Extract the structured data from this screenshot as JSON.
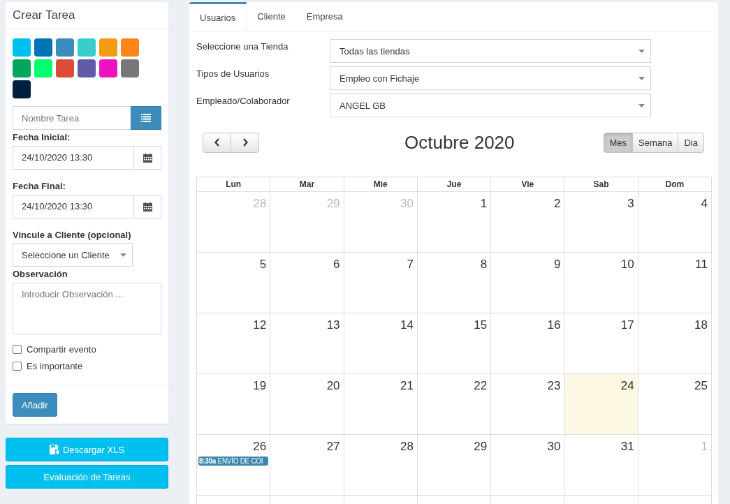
{
  "task_form": {
    "title": "Crear Tarea",
    "swatches": [
      {
        "color": "#00c0ef"
      },
      {
        "color": "#0073b7"
      },
      {
        "color": "#3c8dbc"
      },
      {
        "color": "#39cccc"
      },
      {
        "color": "#f39c12"
      },
      {
        "color": "#ff851b"
      },
      {
        "color": "#00a65a"
      },
      {
        "color": "#01ff70"
      },
      {
        "color": "#dd4b39"
      },
      {
        "color": "#605ca8"
      },
      {
        "color": "#f012be"
      },
      {
        "color": "#777777"
      },
      {
        "color": "#001f3f"
      }
    ],
    "name_field": {
      "placeholder": "Nombre Tarea"
    },
    "start_label": "Fecha Inicial:",
    "start_value": "24/10/2020 13:30",
    "end_label": "Fecha Final:",
    "end_value": "24/10/2020 13:30",
    "client_label": "Vincule a Cliente (opcional)",
    "client_select": "Seleccione un Cliente",
    "notes_label": "Observación",
    "notes": {
      "placeholder": "Introducir Observación ..."
    },
    "checkboxes": [
      {
        "label": "Compartir evento",
        "checked": false
      },
      {
        "label": "Es importante",
        "checked": false
      }
    ],
    "submit": "Añadir"
  },
  "side_buttons": [
    {
      "label": "Descargar XLS",
      "kind": "download"
    },
    {
      "label": "Evaluación de Tareas",
      "kind": "plain"
    }
  ],
  "tabs": [
    {
      "label": "Usuarios",
      "selected": true
    },
    {
      "label": "Cliente",
      "selected": false
    },
    {
      "label": "Empresa",
      "selected": false
    }
  ],
  "filters": [
    {
      "label": "Seleccione una Tienda",
      "value": "Todas las tiendas"
    },
    {
      "label": "Tipos de Usuarios",
      "value": "Empleo con Fichaje"
    },
    {
      "label": "Empleado/Colaborador",
      "value": "ANGEL GB"
    }
  ],
  "calendar": {
    "title": "Octubre 2020",
    "views": [
      {
        "label": "Mes",
        "selected": true
      },
      {
        "label": "Semana",
        "selected": false
      },
      {
        "label": "Dia",
        "selected": false
      }
    ],
    "weekdays": [
      "Lun",
      "Mar",
      "Mie",
      "Jue",
      "Vie",
      "Sab",
      "Dom"
    ],
    "weeks": [
      [
        {
          "day": "28",
          "other": true
        },
        {
          "day": "29",
          "other": true
        },
        {
          "day": "30",
          "other": true
        },
        {
          "day": "1",
          "other": false
        },
        {
          "day": "2",
          "other": false
        },
        {
          "day": "3",
          "other": false
        },
        {
          "day": "4",
          "other": false
        }
      ],
      [
        {
          "day": "5",
          "other": false
        },
        {
          "day": "6",
          "other": false
        },
        {
          "day": "7",
          "other": false
        },
        {
          "day": "8",
          "other": false
        },
        {
          "day": "9",
          "other": false
        },
        {
          "day": "10",
          "other": false
        },
        {
          "day": "11",
          "other": false
        }
      ],
      [
        {
          "day": "12",
          "other": false
        },
        {
          "day": "13",
          "other": false
        },
        {
          "day": "14",
          "other": false
        },
        {
          "day": "15",
          "other": false
        },
        {
          "day": "16",
          "other": false
        },
        {
          "day": "17",
          "other": false
        },
        {
          "day": "18",
          "other": false
        }
      ],
      [
        {
          "day": "19",
          "other": false
        },
        {
          "day": "20",
          "other": false
        },
        {
          "day": "21",
          "other": false
        },
        {
          "day": "22",
          "other": false
        },
        {
          "day": "23",
          "other": false
        },
        {
          "day": "24",
          "other": false,
          "today": true
        },
        {
          "day": "25",
          "other": false
        }
      ],
      [
        {
          "day": "26",
          "other": false,
          "events": [
            {
              "time": "8:30a",
              "title": "ENVÍO DE COI"
            }
          ]
        },
        {
          "day": "27",
          "other": false
        },
        {
          "day": "28",
          "other": false
        },
        {
          "day": "29",
          "other": false
        },
        {
          "day": "30",
          "other": false
        },
        {
          "day": "31",
          "other": false
        },
        {
          "day": "1",
          "other": true
        }
      ]
    ]
  }
}
